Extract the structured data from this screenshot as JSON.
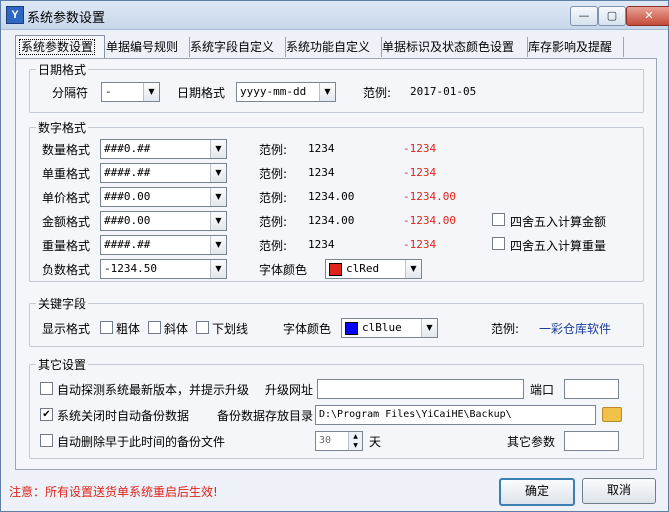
{
  "window": {
    "title": "系统参数设置",
    "app_icon": "Y",
    "min_glyph": "—",
    "max_glyph": "▢",
    "close_glyph": "✕"
  },
  "tabs": [
    {
      "label": "系统参数设置"
    },
    {
      "label": "单据编号规则"
    },
    {
      "label": "系统字段自定义"
    },
    {
      "label": "系统功能自定义"
    },
    {
      "label": "单据标识及状态颜色设置"
    },
    {
      "label": "库存影响及提醒"
    }
  ],
  "date_group": {
    "title": "日期格式",
    "separator_label": "分隔符",
    "separator_value": "-",
    "format_label": "日期格式",
    "format_value": "yyyy-mm-dd",
    "example_label": "范例:",
    "example_value": "2017-01-05"
  },
  "number_group": {
    "title": "数字格式",
    "example_label": "范例:",
    "rows": [
      {
        "label": "数量格式",
        "value": "###0.##",
        "pos": "1234",
        "neg": "-1234"
      },
      {
        "label": "单重格式",
        "value": "####.##",
        "pos": "1234",
        "neg": "-1234"
      },
      {
        "label": "单价格式",
        "value": "###0.00",
        "pos": "1234.00",
        "neg": "-1234.00"
      },
      {
        "label": "金额格式",
        "value": "###0.00",
        "pos": "1234.00",
        "neg": "-1234.00"
      },
      {
        "label": "重量格式",
        "value": "####.##",
        "pos": "1234",
        "neg": "-1234"
      }
    ],
    "round_amount_label": "四舍五入计算金额",
    "round_weight_label": "四舍五入计算重量",
    "negative_label": "负数格式",
    "negative_value": "-1234.50",
    "font_color_label": "字体颜色",
    "font_color_value": "clRed",
    "font_color_hex": "#e0241b"
  },
  "key_group": {
    "title": "关键字段",
    "display_label": "显示格式",
    "bold_label": "粗体",
    "italic_label": "斜体",
    "underline_label": "下划线",
    "font_color_label": "字体颜色",
    "font_color_value": "clBlue",
    "font_color_hex": "#0000ff",
    "example_label": "范例:",
    "example_value": "一彩仓库软件"
  },
  "other_group": {
    "title": "其它设置",
    "auto_detect_label": "自动探测系统最新版本，并提示升级",
    "upgrade_url_label": "升级网址",
    "upgrade_url_value": "",
    "port_label": "端口",
    "port_value": "",
    "auto_backup_label": "系统关闭时自动备份数据",
    "auto_backup_checked": true,
    "backup_dir_label": "备份数据存放目录",
    "backup_dir_value": "D:\\Program Files\\YiCaiHE\\Backup\\",
    "auto_delete_label": "自动删除早于此时间的备份文件",
    "days_value": "30",
    "days_unit": "天",
    "other_param_label": "其它参数",
    "other_param_value": ""
  },
  "footer": {
    "note": "注意：所有设置送货单系统重启后生效!",
    "ok_label": "确定",
    "cancel_label": "取消"
  }
}
